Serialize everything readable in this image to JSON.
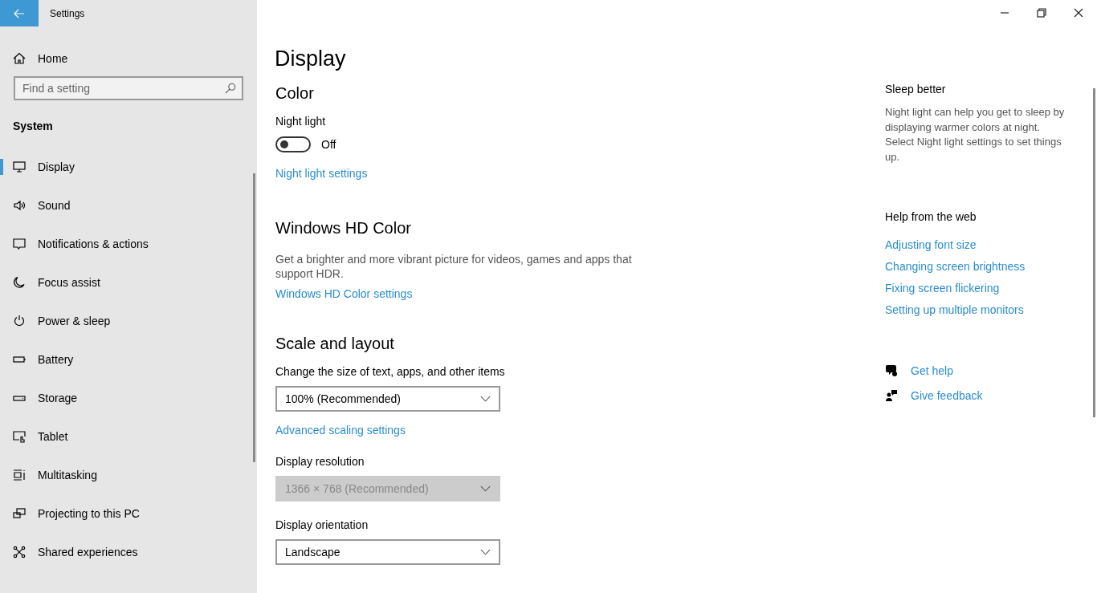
{
  "window": {
    "title": "Settings"
  },
  "sidebar": {
    "home": "Home",
    "search": {
      "placeholder": "Find a setting"
    },
    "section": "System",
    "items": [
      {
        "label": "Display",
        "selected": true
      },
      {
        "label": "Sound",
        "selected": false
      },
      {
        "label": "Notifications & actions",
        "selected": false
      },
      {
        "label": "Focus assist",
        "selected": false
      },
      {
        "label": "Power & sleep",
        "selected": false
      },
      {
        "label": "Battery",
        "selected": false
      },
      {
        "label": "Storage",
        "selected": false
      },
      {
        "label": "Tablet",
        "selected": false
      },
      {
        "label": "Multitasking",
        "selected": false
      },
      {
        "label": "Projecting to this PC",
        "selected": false
      },
      {
        "label": "Shared experiences",
        "selected": false
      }
    ]
  },
  "page": {
    "title": "Display",
    "sections": [
      {
        "heading": "Color",
        "items": [
          {
            "kind": "toggle",
            "label": "Night light",
            "on": false,
            "state_text": "Off"
          },
          {
            "kind": "link",
            "text": "Night light settings"
          }
        ]
      },
      {
        "heading": "Windows HD Color",
        "items": [
          {
            "kind": "text",
            "text": "Get a brighter and more vibrant picture for videos, games and apps that support HDR."
          },
          {
            "kind": "link",
            "text": "Windows HD Color settings"
          }
        ]
      },
      {
        "heading": "Scale and layout",
        "items": [
          {
            "kind": "dropdown",
            "label": "Change the size of text, apps, and other items",
            "value": "100% (Recommended)",
            "disabled": false
          },
          {
            "kind": "link",
            "text": "Advanced scaling settings"
          },
          {
            "kind": "dropdown",
            "label": "Display resolution",
            "value": "1366 × 768 (Recommended)",
            "disabled": true
          },
          {
            "kind": "dropdown",
            "label": "Display orientation",
            "value": "Landscape",
            "disabled": false
          }
        ]
      }
    ]
  },
  "aside": {
    "tip": {
      "heading": "Sleep better",
      "text": "Night light can help you get to sleep by displaying warmer colors at night. Select Night light settings to set things up."
    },
    "help": {
      "heading": "Help from the web",
      "links": [
        "Adjusting font size",
        "Changing screen brightness",
        "Fixing screen flickering",
        "Setting up multiple monitors"
      ]
    },
    "actions": [
      "Get help",
      "Give feedback"
    ]
  }
}
